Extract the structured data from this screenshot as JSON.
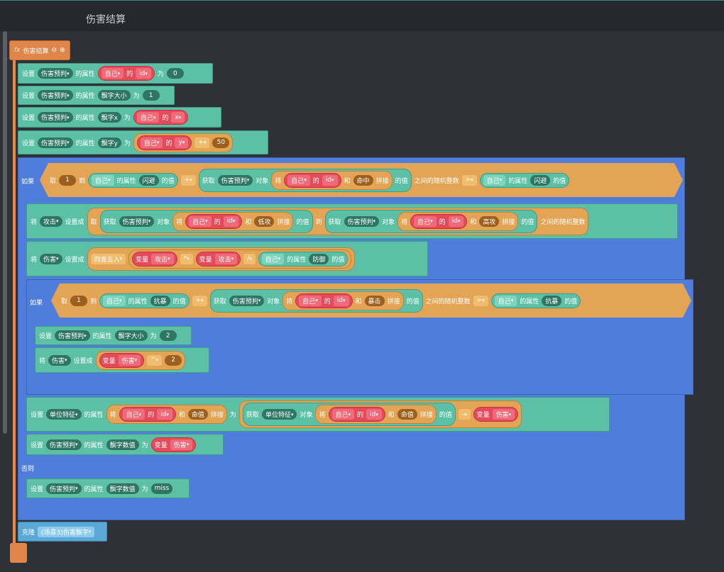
{
  "window": {
    "title": "伤害结算"
  },
  "fn": {
    "icon": "fx",
    "name": "伤害结算",
    "minus": "⊖",
    "plus": "⊕"
  },
  "kw": {
    "set": "设置",
    "prop": "的属性",
    "to": "为",
    "of": "的",
    "if": "如果",
    "else": "否则",
    "assign": "将",
    "setto": "设置成",
    "take": "取",
    "range_to": "到",
    "get": "获取",
    "obj": "对象",
    "and": "和",
    "concat": "拼接",
    "val": "的值",
    "randint": "之间的随机整数",
    "var": "变量",
    "clone": "克隆"
  },
  "dd": {
    "judge": "伤害预判",
    "self": "自己",
    "id": "id",
    "x": "x",
    "y": "y",
    "plus": "+",
    "gt": ">",
    "mul": "*",
    "div": "/",
    "pow": "^",
    "minus": "-",
    "attack": "攻击",
    "damage": "伤害",
    "round": "四舍五入",
    "unit_feature": "单位特征",
    "clone_target": "(场景3)伤害飘字"
  },
  "fields": {
    "font_size": "飘字大小",
    "font_x": "飘字x",
    "font_y": "飘字y",
    "dodge": "闪避",
    "hit": "命中",
    "low_atk": "低攻",
    "high_atk": "高攻",
    "defense": "防御",
    "crit_res": "抗暴",
    "crit": "暴击",
    "hp": "命值",
    "font_val": "飘字数值"
  },
  "nums": {
    "n0": "0",
    "n1": "1",
    "n2": "2",
    "n50": "50",
    "miss": "miss"
  }
}
